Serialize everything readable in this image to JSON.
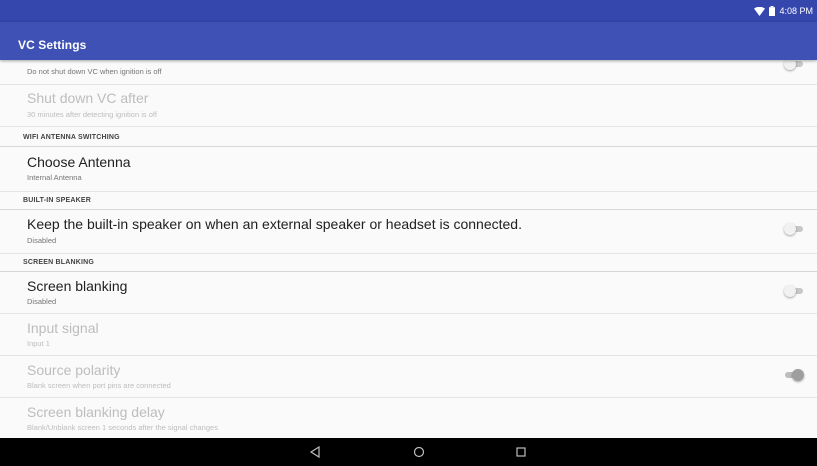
{
  "status_bar": {
    "time": "4:08 PM"
  },
  "app_bar": {
    "title": "VC Settings"
  },
  "prefs": {
    "ignition": {
      "summary": "Do not shut down VC when ignition is off",
      "switch_on": false
    },
    "shutdown": {
      "title": "Shut down VC after",
      "summary": "30 minutes after detecting ignition is off"
    },
    "wifi_category": "WIFI ANTENNA SWITCHING",
    "antenna": {
      "title": "Choose Antenna",
      "summary": "Internal Antenna"
    },
    "speaker_category": "BUILT-IN SPEAKER",
    "speaker": {
      "title": "Keep the built-in speaker on when an external speaker or headset is connected.",
      "summary": "Disabled",
      "switch_on": false
    },
    "blanking_category": "SCREEN BLANKING",
    "blanking": {
      "title": "Screen blanking",
      "summary": "Disabled",
      "switch_on": false
    },
    "input_signal": {
      "title": "Input signal",
      "summary": "Input 1"
    },
    "source_polarity": {
      "title": "Source polarity",
      "summary": "Blank screen when port pins are connected",
      "switch_on": true
    },
    "blanking_delay": {
      "title": "Screen blanking delay",
      "summary": "Blank/Unblank screen 1 seconds after the signal changes"
    }
  },
  "nav_bar": {
    "back_icon": "back-triangle",
    "home_icon": "home-circle",
    "recents_icon": "recents-square"
  },
  "colors": {
    "status_bar": "#3547ad",
    "app_bar": "#3f51b5",
    "background": "#fafafa"
  }
}
